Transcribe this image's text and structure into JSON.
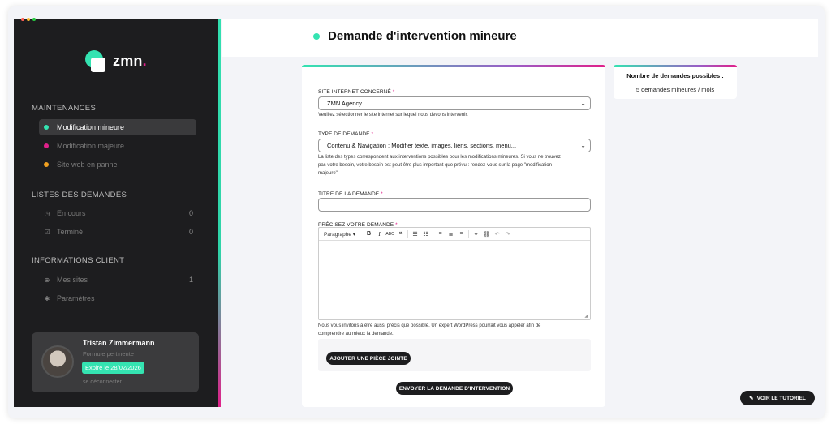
{
  "colors": {
    "accent": "#34e3b1",
    "pink": "#e0208a",
    "orange": "#f0a020",
    "sidebar_bg": "#1d1d1f"
  },
  "brand": {
    "name": "zmn",
    "dot": "."
  },
  "sidebar": {
    "sections": [
      {
        "title": "MAINTENANCES",
        "items": [
          {
            "label": "Modification mineure",
            "bullet": "#34e3b1"
          },
          {
            "label": "Modification majeure",
            "bullet": "#e0208a"
          },
          {
            "label": "Site web en panne",
            "bullet": "#f0a020"
          }
        ]
      },
      {
        "title": "LISTES DES DEMANDES",
        "items": [
          {
            "label": "En cours",
            "icon": "clock-icon",
            "count": "0"
          },
          {
            "label": "Terminé",
            "icon": "check-square-icon",
            "count": "0"
          }
        ]
      },
      {
        "title": "INFORMATIONS CLIENT",
        "items": [
          {
            "label": "Mes sites",
            "icon": "globe-icon",
            "count": "1"
          },
          {
            "label": "Paramètres",
            "icon": "gear-icon"
          }
        ]
      }
    ]
  },
  "user": {
    "name": "Tristan Zimmermann",
    "role": "Formule pertinente",
    "expire": "Expire le 28/02/2026",
    "logout": "se déconnecter"
  },
  "header": {
    "title": "Demande d'intervention mineure"
  },
  "form": {
    "site_label": "SITE INTERNET CONCERNÉ",
    "required": "*",
    "site_value": "ZMN Agency",
    "site_help": "Veuillez sélectionner le site internet sur lequel nous devons intervenir.",
    "type_label": "TYPE DE DEMANDE",
    "type_value": "Contenu & Navigation : Modifier texte, images, liens, sections, menu...",
    "type_help_1": "La liste des types correspondent aux interventions possibles pour les modifications mineures. Si vous ne trouvez",
    "type_help_2": "pas votre besoin, votre besoin est peut être plus important que prévu : rendez-vous sur la page \"modification",
    "type_help_3": "majeure\".",
    "title_label": "TITRE DE LA DEMANDE",
    "details_label": "PRÉCISEZ VOTRE DEMANDE",
    "toolbar_paragraph": "Paragraphe",
    "details_help_1": "Nous vous invitons à être aussi précis que possible. Un expert WordPress pourrait vous appeler afin de",
    "details_help_2": "comprendre au mieux la demande.",
    "attach_button": "AJOUTER UNE PIÈCE JOINTE",
    "submit_button": "ENVOYER LA DEMANDE D'INTERVENTION"
  },
  "quota": {
    "title": "Nombre de demandes possibles :",
    "value": "5 demandes mineures / mois"
  },
  "tutorial": {
    "label": "VOIR LE TUTORIEL"
  }
}
